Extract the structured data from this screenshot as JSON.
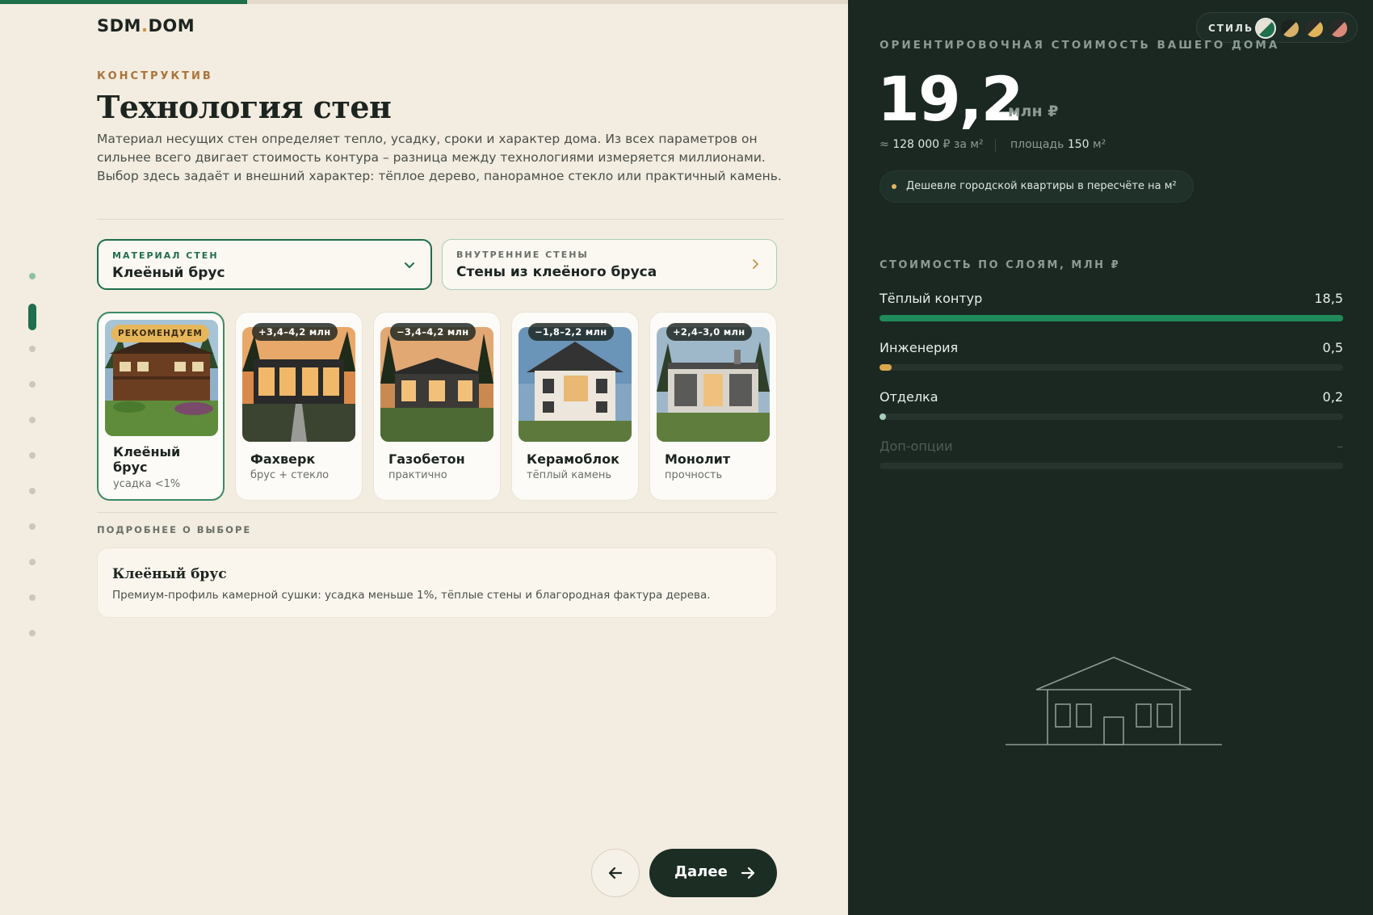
{
  "progress": {
    "fraction": 0.18
  },
  "brand": {
    "name_part1": "SDM",
    "name_dot": ".",
    "name_part2": "DOM"
  },
  "steps": {
    "count": 11,
    "current": 2,
    "completed": 1
  },
  "section": {
    "eyebrow": "КОНСТРУКТИВ",
    "title": "Технология стен",
    "description": "Материал несущих стен определяет тепло, усадку, сроки и характер дома. Из всех параметров он сильнее всего двигает стоимость контура – разница между технологиями измеряется миллионами. Выбор здесь задаёт и внешний характер: тёплое дерево, панорамное стекло или практичный камень."
  },
  "selectors": {
    "material": {
      "label": "МАТЕРИАЛ СТЕН",
      "value": "Клеёный брус"
    },
    "inner": {
      "label": "ВНУТРЕННИЕ СТЕНЫ",
      "value": "Стены из клеёного бруса"
    }
  },
  "options": [
    {
      "name": "Клеёный брус",
      "sub": "усадка <1%",
      "badge": "РЕКОМЕНДУЕМ",
      "selected": true
    },
    {
      "name": "Фахверк",
      "sub": "брус + стекло",
      "badge": "+3,4–4,2 млн",
      "selected": false
    },
    {
      "name": "Газобетон",
      "sub": "практично",
      "badge": "−3,4–4,2 млн",
      "selected": false
    },
    {
      "name": "Керамоблок",
      "sub": "тёплый камень",
      "badge": "−1,8–2,2 млн",
      "selected": false
    },
    {
      "name": "Монолит",
      "sub": "прочность",
      "badge": "+2,4–3,0 млн",
      "selected": false
    }
  ],
  "more": {
    "label": "ПОДРОБНЕЕ О ВЫБОРЕ",
    "title": "Клеёный брус",
    "text": "Премиум-профиль камерной сушки: усадка меньше 1%, тёплые стены и благородная фактура дерева."
  },
  "nav": {
    "next_label": "Далее"
  },
  "summary": {
    "style_label": "СТИЛЬ",
    "estimate_label": "ОРИЕНТИРОВОЧНАЯ СТОИМОСТЬ ВАШЕГО ДОМА",
    "price": "19,2",
    "price_unit": "млн ₽",
    "per_m_prefix": "≈",
    "per_m_value": "128 000",
    "per_m_suffix": "₽ за м²",
    "area_prefix": "площадь",
    "area_value": "150",
    "area_suffix": "м²",
    "note": "Дешевле городской квартиры в пересчёте на м²",
    "layers_label": "СТОИМОСТЬ ПО СЛОЯМ, МЛН ₽",
    "layers": [
      {
        "name": "Тёплый контур",
        "value": "18,5",
        "fraction": 1.0,
        "color": "#1f8a5a"
      },
      {
        "name": "Инженерия",
        "value": "0,5",
        "fraction": 0.027,
        "color": "#d9a94e"
      },
      {
        "name": "Отделка",
        "value": "0,2",
        "fraction": 0.011,
        "color": "#a9cdb8"
      },
      {
        "name": "Доп-опции",
        "value": "–",
        "fraction": 0,
        "color": "#27342e"
      }
    ]
  },
  "colors": {
    "accent": "#1f6e4c",
    "gold": "#c7913f",
    "dark_panel": "#1b2822"
  }
}
